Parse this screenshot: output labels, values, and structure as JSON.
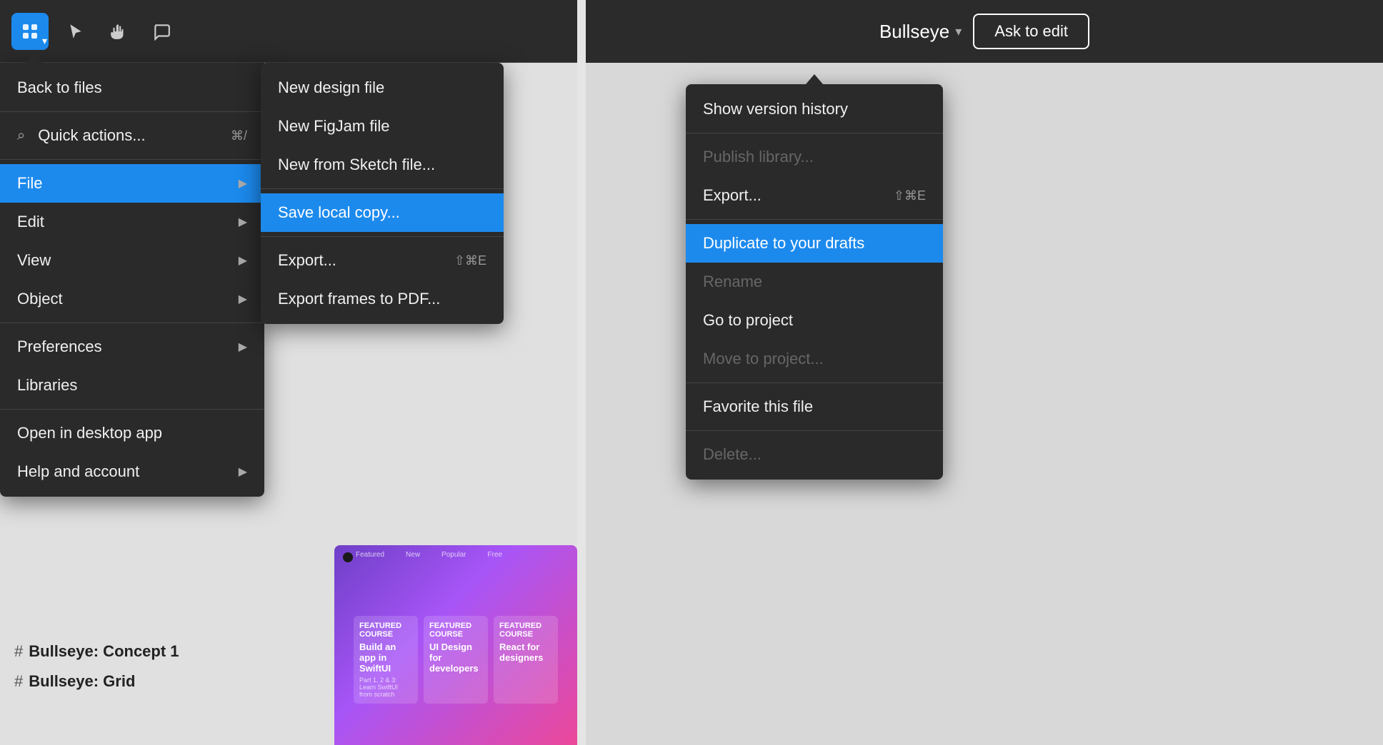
{
  "left_toolbar": {
    "logo_label": "Figma menu",
    "tools": [
      {
        "name": "move-tool",
        "label": "Move"
      },
      {
        "name": "hand-tool",
        "label": "Hand"
      },
      {
        "name": "comment-tool",
        "label": "Comment"
      }
    ]
  },
  "left_menu": {
    "back_to_files": "Back to files",
    "quick_actions": "Quick actions...",
    "quick_actions_shortcut": "⌘/",
    "items": [
      {
        "label": "File",
        "has_arrow": true,
        "active": true
      },
      {
        "label": "Edit",
        "has_arrow": true
      },
      {
        "label": "View",
        "has_arrow": true
      },
      {
        "label": "Object",
        "has_arrow": true
      },
      {
        "label": "Preferences",
        "has_arrow": true
      },
      {
        "label": "Libraries",
        "has_arrow": false
      }
    ],
    "bottom_items": [
      {
        "label": "Open in desktop app",
        "has_arrow": false
      },
      {
        "label": "Help and account",
        "has_arrow": true
      }
    ]
  },
  "file_submenu": {
    "items": [
      {
        "label": "New design file",
        "active": false
      },
      {
        "label": "New FigJam file",
        "active": false
      },
      {
        "label": "New from Sketch file...",
        "active": false
      },
      {
        "label": "Save local copy...",
        "active": true
      },
      {
        "label": "Export...",
        "shortcut": "⇧⌘E",
        "active": false
      },
      {
        "label": "Export frames to PDF...",
        "active": false
      }
    ]
  },
  "right_toolbar": {
    "project_name": "Bullseye",
    "ask_edit_label": "Ask to edit"
  },
  "right_menu": {
    "items": [
      {
        "label": "Show version history",
        "active": false,
        "disabled": false
      },
      {
        "label": "Publish library...",
        "active": false,
        "disabled": true
      },
      {
        "label": "Export...",
        "shortcut": "⇧⌘E",
        "active": false,
        "disabled": false
      },
      {
        "label": "Duplicate to your drafts",
        "active": true,
        "disabled": false
      },
      {
        "label": "Rename",
        "active": false,
        "disabled": true
      },
      {
        "label": "Go to project",
        "active": false,
        "disabled": false
      },
      {
        "label": "Move to project...",
        "active": false,
        "disabled": true
      },
      {
        "label": "Favorite this file",
        "active": false,
        "disabled": false
      },
      {
        "label": "Delete...",
        "active": false,
        "disabled": true
      }
    ]
  },
  "frames": [
    {
      "label": "Bullseye: Concept 1"
    },
    {
      "label": "Bullseye: Grid"
    }
  ],
  "thumbnail": {
    "title": "Build an app in SwiftUI",
    "cards": [
      {
        "text": "Build an app in SwiftUI"
      },
      {
        "text": "UI Design for developers"
      },
      {
        "text": "React for designers"
      }
    ]
  }
}
